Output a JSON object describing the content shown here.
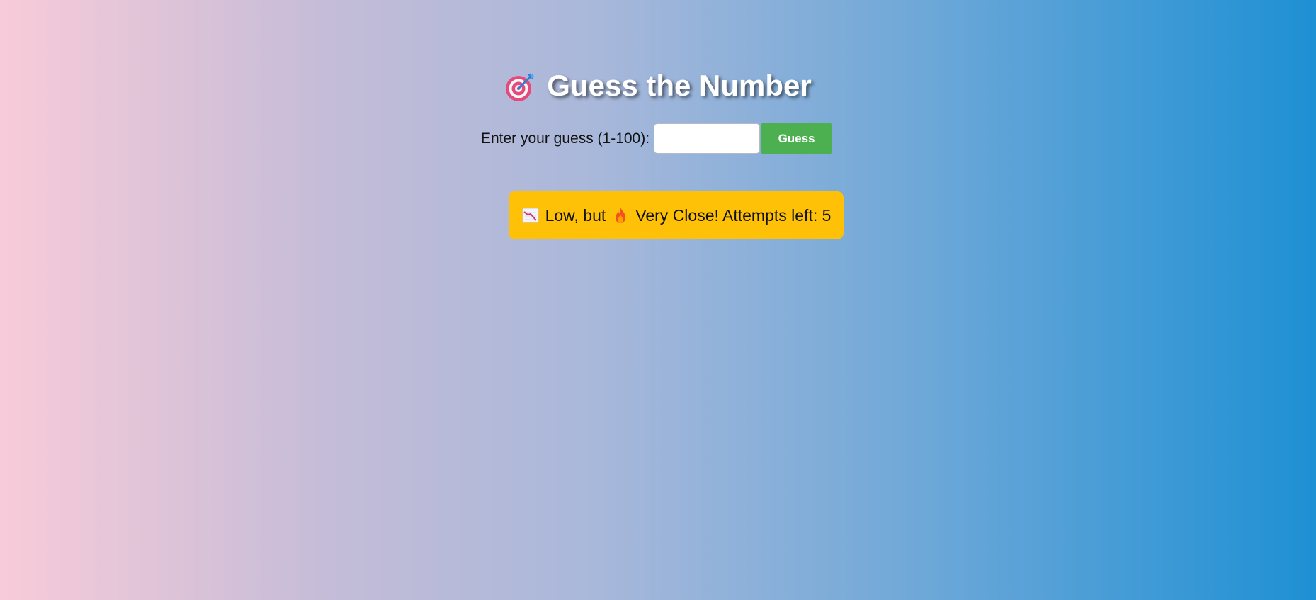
{
  "app": {
    "title": "Guess the Number",
    "title_icon": "target-icon"
  },
  "guess_form": {
    "label": "Enter your guess (1-100):",
    "input_value": "",
    "input_placeholder": "",
    "button_label": "Guess"
  },
  "feedback": {
    "direction_icon": "chart-decreasing-icon",
    "direction_text": "Low, but",
    "proximity_icon": "fire-icon",
    "message_text": "Very Close! Attempts left: 5",
    "background_color": "#ffc107"
  },
  "colors": {
    "button_green": "#4caf50",
    "feedback_yellow": "#ffc107"
  }
}
